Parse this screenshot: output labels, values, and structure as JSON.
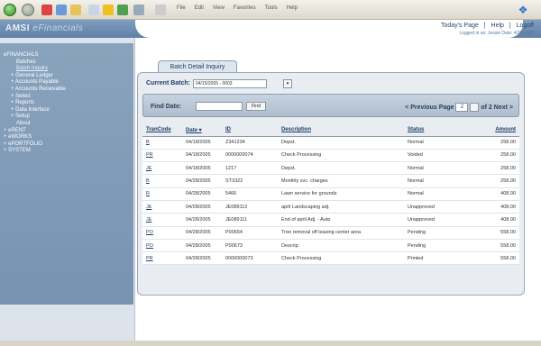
{
  "app": {
    "logo_text": "AMSI",
    "logo_sub": "eFinancials",
    "header_links": [
      "Today's Page",
      "|",
      "Help",
      "|",
      "Logoff"
    ],
    "logged_in": "Logged in as: Jessie   Date: 4/29/2005"
  },
  "browser": {
    "menu": [
      "File",
      "Edit",
      "View",
      "Favorites",
      "Tools",
      "Help"
    ]
  },
  "sidebar": {
    "items": [
      {
        "label": "eFINANCIALS",
        "level": 0
      },
      {
        "label": "Batches",
        "level": 2
      },
      {
        "label": "Batch Inquiry",
        "level": 2,
        "selected": true
      },
      {
        "label": "+ General Ledger",
        "level": 1
      },
      {
        "label": "+ Accounts Payable",
        "level": 1
      },
      {
        "label": "+ Accounts Receivable",
        "level": 1
      },
      {
        "label": "+ Select",
        "level": 1
      },
      {
        "label": "+ Reports",
        "level": 1
      },
      {
        "label": "+ Data Interface",
        "level": 1
      },
      {
        "label": "+ Setup",
        "level": 1
      },
      {
        "label": "About",
        "level": 2
      },
      {
        "label": "+ eRENT",
        "level": 0
      },
      {
        "label": "+ eWORKS",
        "level": 0
      },
      {
        "label": "+ ePORTFOLIO",
        "level": 0
      },
      {
        "label": "+ SYSTEM",
        "level": 0
      }
    ]
  },
  "main": {
    "tab_label": "Batch Detail Inquiry",
    "current_batch_label": "Current Batch:",
    "current_batch_value": "04/15/2005 - 0003",
    "find_date_label": "Find Date:",
    "find_button": "Find",
    "pager": {
      "prev": "< Previous",
      "page_label": "Page",
      "page_value": "2",
      "of_label": "of 2",
      "next": "Next >"
    },
    "columns": [
      "TranCode",
      "Date ▾",
      "ID",
      "Description",
      "Status",
      "Amount"
    ],
    "rows": [
      [
        "B",
        "04/18/2005",
        "Z341234",
        "Depst.",
        "Normal",
        "258.00"
      ],
      [
        "PR",
        "04/18/2005",
        "0000000074",
        "Check Processing",
        "Voided",
        "258.00"
      ],
      [
        "JE",
        "04/18/2005",
        "1217",
        "Depst.",
        "Normal",
        "258.00"
      ],
      [
        "B",
        "04/28/2005",
        "ST3322",
        "Monthly svc. charges",
        "Normal",
        "258.00"
      ],
      [
        "R",
        "04/28/2005",
        "5466",
        "Lawn service for grounds",
        "Normal",
        "408.00"
      ],
      [
        "JE",
        "04/28/2005",
        "JE089112",
        "april Landscaping adj.",
        "Unapproved",
        "408.00"
      ],
      [
        "JE",
        "04/28/2005",
        "JE089111",
        "End of april Adj. - Auto",
        "Unapproved",
        "408.00"
      ],
      [
        "PO",
        "04/28/2005",
        "P00654",
        "Tree removal off leasing center area",
        "Pending",
        "558.00"
      ],
      [
        "PO",
        "04/28/2005",
        "P00673",
        "Descrip.",
        "Pending",
        "558.00"
      ],
      [
        "PR",
        "04/28/2005",
        "0000000073",
        "Check Processing",
        "Printed",
        "558.00"
      ]
    ]
  }
}
